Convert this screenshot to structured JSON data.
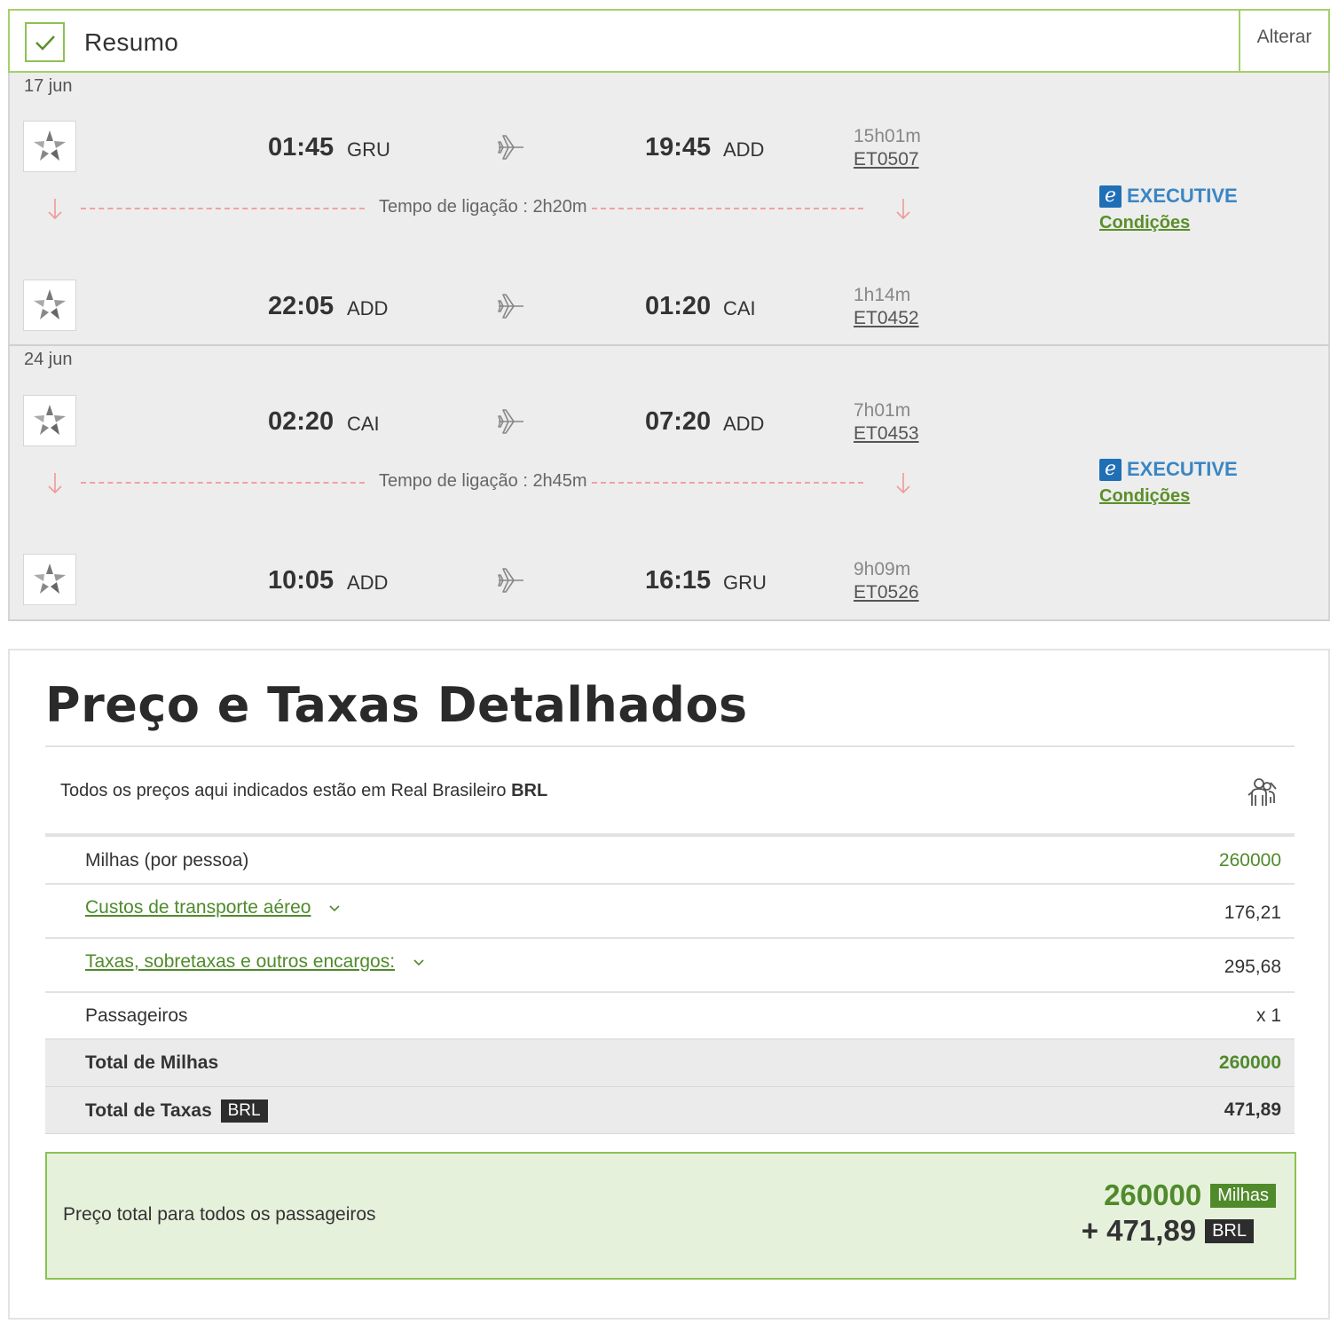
{
  "summary": {
    "title": "Resumo",
    "change_label": "Alterar"
  },
  "bounds": [
    {
      "date": "17 jun",
      "segments": [
        {
          "dep_time": "01:45",
          "dep_code": "GRU",
          "arr_time": "19:45",
          "arr_code": "ADD",
          "duration": "15h01m",
          "flight": "ET0507"
        },
        {
          "dep_time": "22:05",
          "dep_code": "ADD",
          "arr_time": "01:20",
          "arr_code": "CAI",
          "duration": "1h14m",
          "flight": "ET0452"
        }
      ],
      "layover": "Tempo de ligação : 2h20m",
      "cabin": {
        "badge": "e",
        "name": "EXECUTIVE",
        "conditions": "Condições"
      }
    },
    {
      "date": "24 jun",
      "segments": [
        {
          "dep_time": "02:20",
          "dep_code": "CAI",
          "arr_time": "07:20",
          "arr_code": "ADD",
          "duration": "7h01m",
          "flight": "ET0453"
        },
        {
          "dep_time": "10:05",
          "dep_code": "ADD",
          "arr_time": "16:15",
          "arr_code": "GRU",
          "duration": "9h09m",
          "flight": "ET0526"
        }
      ],
      "layover": "Tempo de ligação : 2h45m",
      "cabin": {
        "badge": "e",
        "name": "EXECUTIVE",
        "conditions": "Condições"
      }
    }
  ],
  "price": {
    "title": "Preço e Taxas Detalhados",
    "currency_note": "Todos os preços aqui indicados estão em Real Brasileiro",
    "currency_code": "BRL",
    "rows": {
      "miles_label": "Milhas (por pessoa)",
      "miles_value": "260000",
      "transport_label": "Custos de transporte aéreo",
      "transport_value": "176,21",
      "taxes_label": "Taxas, sobretaxas e outros encargos:",
      "taxes_value": "295,68",
      "passengers_label": "Passageiros",
      "passengers_value": "x 1",
      "total_miles_label": "Total de Milhas",
      "total_miles_value": "260000",
      "total_taxes_label": "Total de Taxas",
      "total_taxes_tag": "BRL",
      "total_taxes_value": "471,89"
    },
    "grand": {
      "label": "Preço total para todos os passageiros",
      "miles": "260000",
      "miles_tag": "Milhas",
      "brl": "+ 471,89",
      "brl_tag": "BRL"
    }
  },
  "icons": {
    "check": "check-icon",
    "airline": "star-alliance-logo-icon",
    "plane": "plane-icon",
    "arrow": "arrow-down-icon",
    "chevron": "chevron-down-icon",
    "passengers": "passengers-icon"
  },
  "colors": {
    "accent_green": "#4f8a2b",
    "border_green": "#8cc152",
    "cabin_blue": "#3a86c4",
    "layover_red": "#f1a2a2"
  }
}
